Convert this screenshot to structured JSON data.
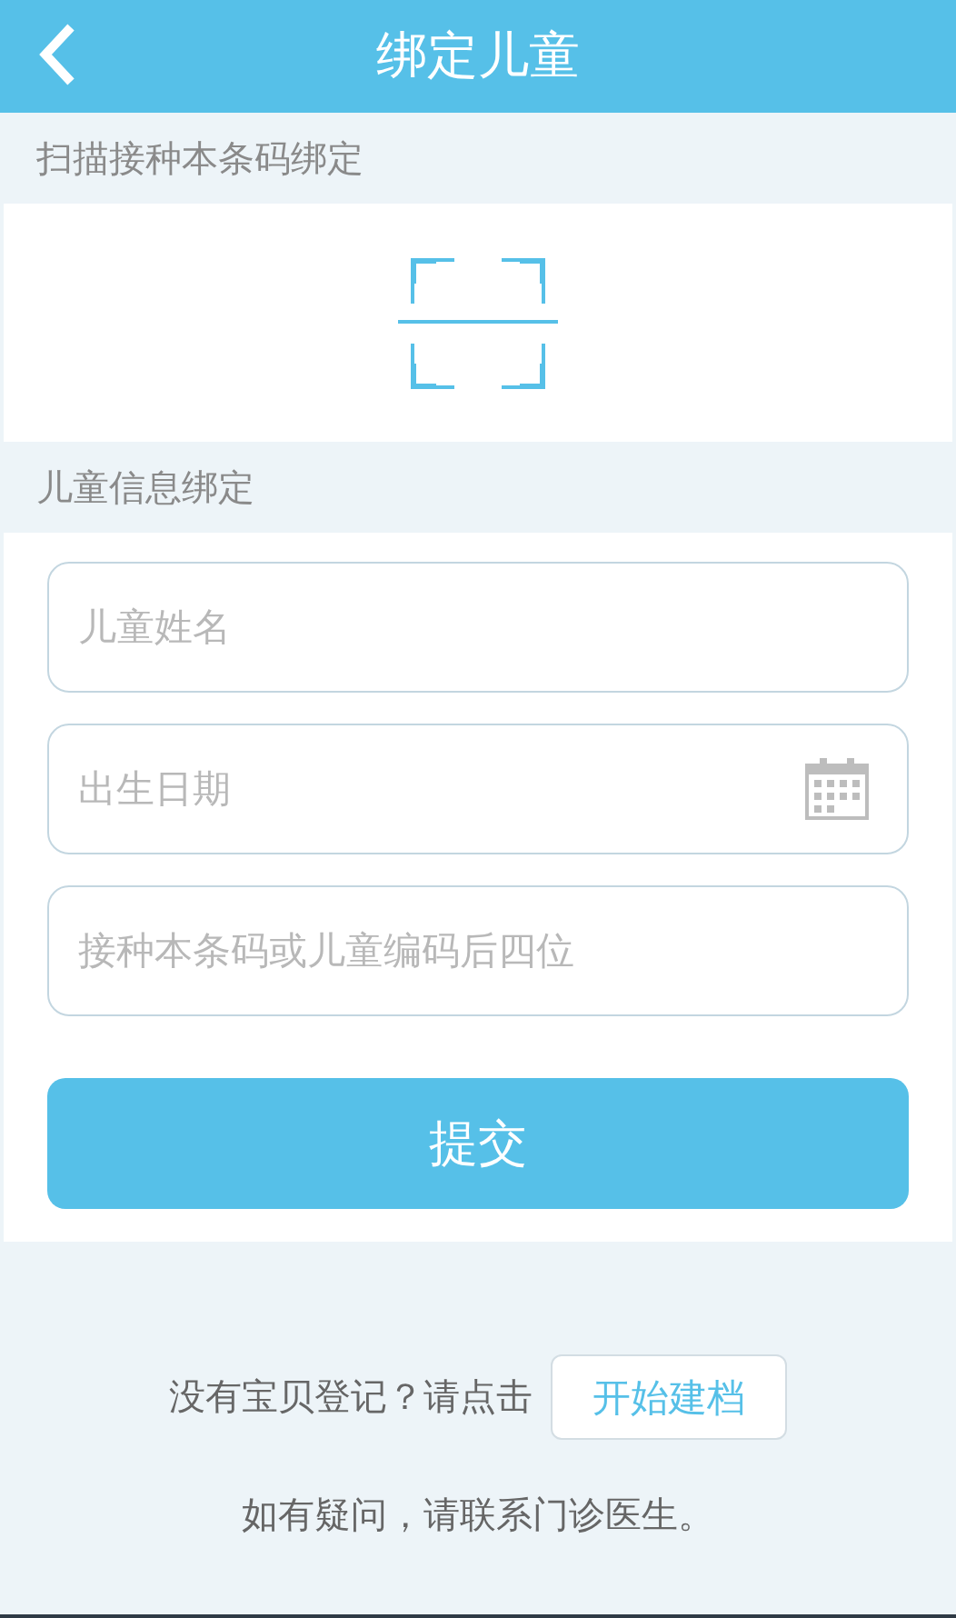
{
  "header": {
    "title": "绑定儿童"
  },
  "scan_section": {
    "label": "扫描接种本条码绑定"
  },
  "info_section": {
    "label": "儿童信息绑定"
  },
  "fields": [
    {
      "kind": "text",
      "placeholder": "儿童姓名"
    },
    {
      "kind": "date",
      "placeholder": "出生日期"
    },
    {
      "kind": "text",
      "placeholder": "接种本条码或儿童编码后四位"
    }
  ],
  "submit_button": "提交",
  "register": {
    "prompt": "没有宝贝登记？请点击",
    "button": "开始建档"
  },
  "footer_note": "如有疑问，请联系门诊医生。"
}
